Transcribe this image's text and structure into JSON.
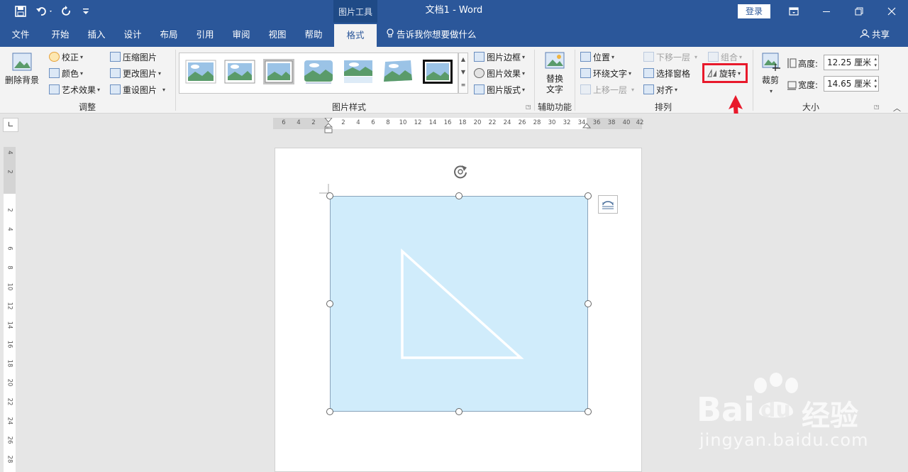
{
  "titlebar": {
    "context_tools": "图片工具",
    "doc_title": "文档1  -  Word",
    "login": "登录"
  },
  "tabs": [
    "文件",
    "开始",
    "插入",
    "设计",
    "布局",
    "引用",
    "审阅",
    "视图",
    "帮助",
    "格式"
  ],
  "active_tab": "格式",
  "tellme": "告诉我你想要做什么",
  "share": "共享",
  "ribbon": {
    "remove_bg": "删除背景",
    "adjust": {
      "correct": "校正",
      "color": "颜色",
      "artistic": "艺术效果",
      "compress": "压缩图片",
      "change": "更改图片",
      "reset": "重设图片",
      "label": "调整"
    },
    "styles": {
      "border": "图片边框",
      "effects": "图片效果",
      "layout": "图片版式",
      "label": "图片样式"
    },
    "alt_text": {
      "line1": "替换",
      "line2": "文字",
      "label": "辅助功能"
    },
    "arrange": {
      "position": "位置",
      "wrap": "环绕文字",
      "forward": "上移一层",
      "backward": "下移一层",
      "selpane": "选择窗格",
      "align": "对齐",
      "group": "组合",
      "rotate": "旋转",
      "label": "排列"
    },
    "size": {
      "crop": "裁剪",
      "height_label": "高度:",
      "height_value": "12.25 厘米",
      "width_label": "宽度:",
      "width_value": "14.65 厘米",
      "label": "大小"
    }
  },
  "ruler_h": [
    "6",
    "4",
    "2",
    "2",
    "4",
    "6",
    "8",
    "10",
    "12",
    "14",
    "16",
    "18",
    "20",
    "22",
    "24",
    "26",
    "28",
    "30",
    "32",
    "34",
    "36",
    "38",
    "40",
    "42"
  ],
  "ruler_v": [
    "4",
    "2",
    "2",
    "4",
    "6",
    "8",
    "10",
    "12",
    "14",
    "16",
    "18",
    "20",
    "22",
    "24",
    "26",
    "28"
  ],
  "watermark": {
    "brand": "Bai",
    "brand2": "du",
    "cn": "经验",
    "url": "jingyan.baidu.com"
  },
  "colors": {
    "title_blue": "#2b579a",
    "picture_bg": "#d0ecfb",
    "highlight_red": "#e8192b"
  }
}
